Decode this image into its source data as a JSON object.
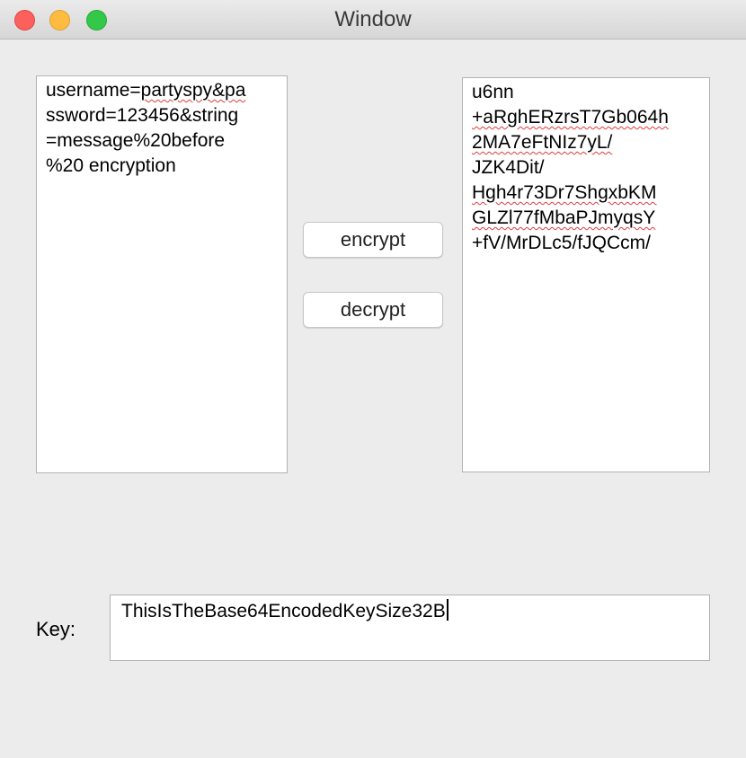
{
  "window": {
    "title": "Window"
  },
  "plaintext": {
    "lines": [
      "username=partyspy&pa",
      "ssword=123456&string",
      "=message%20before",
      "%20 encryption"
    ]
  },
  "ciphertext": {
    "lines": [
      "u6nn",
      "+aRghERzrsT7Gb064h",
      "2MA7eFtNIz7yL/",
      "JZK4Dit/",
      "Hgh4r73Dr7ShgxbKM",
      "GLZl77fMbaPJmyqsY",
      "+fV/MrDLc5/fJQCcm/"
    ]
  },
  "buttons": {
    "encrypt": "encrypt",
    "decrypt": "decrypt"
  },
  "key": {
    "label": "Key:",
    "value": "ThisIsTheBase64EncodedKeySize32B"
  },
  "colors": {
    "close": "#fc605c",
    "minimize": "#fdbc40",
    "maximize": "#34c84a",
    "spellcheck": "#e23b3b"
  }
}
